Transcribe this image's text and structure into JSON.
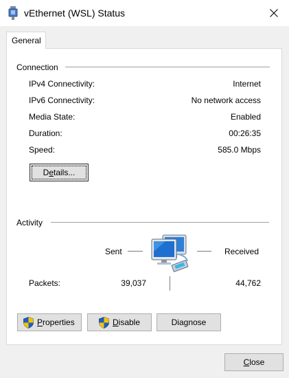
{
  "window": {
    "title": "vEthernet (WSL) Status",
    "icon": "network-adapter-icon",
    "close_glyph": "close-icon"
  },
  "tabs": [
    {
      "label": "General",
      "selected": true
    }
  ],
  "connection": {
    "heading": "Connection",
    "rows": [
      {
        "label": "IPv4 Connectivity:",
        "value": "Internet"
      },
      {
        "label": "IPv6 Connectivity:",
        "value": "No network access"
      },
      {
        "label": "Media State:",
        "value": "Enabled"
      },
      {
        "label": "Duration:",
        "value": "00:26:35"
      },
      {
        "label": "Speed:",
        "value": "585.0 Mbps"
      }
    ],
    "details_label": "Details...",
    "details_mnemonic": "e"
  },
  "activity": {
    "heading": "Activity",
    "sent_label": "Sent",
    "received_label": "Received",
    "packets_label": "Packets:",
    "packets_sent": "39,037",
    "packets_received": "44,762"
  },
  "buttons": {
    "properties": {
      "label": "Properties",
      "mnemonic": "P",
      "rest": "roperties"
    },
    "disable": {
      "label": "Disable",
      "mnemonic": "D",
      "rest": "isable"
    },
    "diagnose": {
      "label": "Diagnose"
    },
    "close": {
      "label": "Close",
      "mnemonic": "C",
      "rest": "lose"
    }
  },
  "colors": {
    "window_bg": "#f0f0f0",
    "panel_bg": "#ffffff",
    "button_bg": "#e1e1e1",
    "button_border": "#adadad",
    "shield_blue": "#1f5fbf",
    "shield_yellow": "#f5c400"
  }
}
